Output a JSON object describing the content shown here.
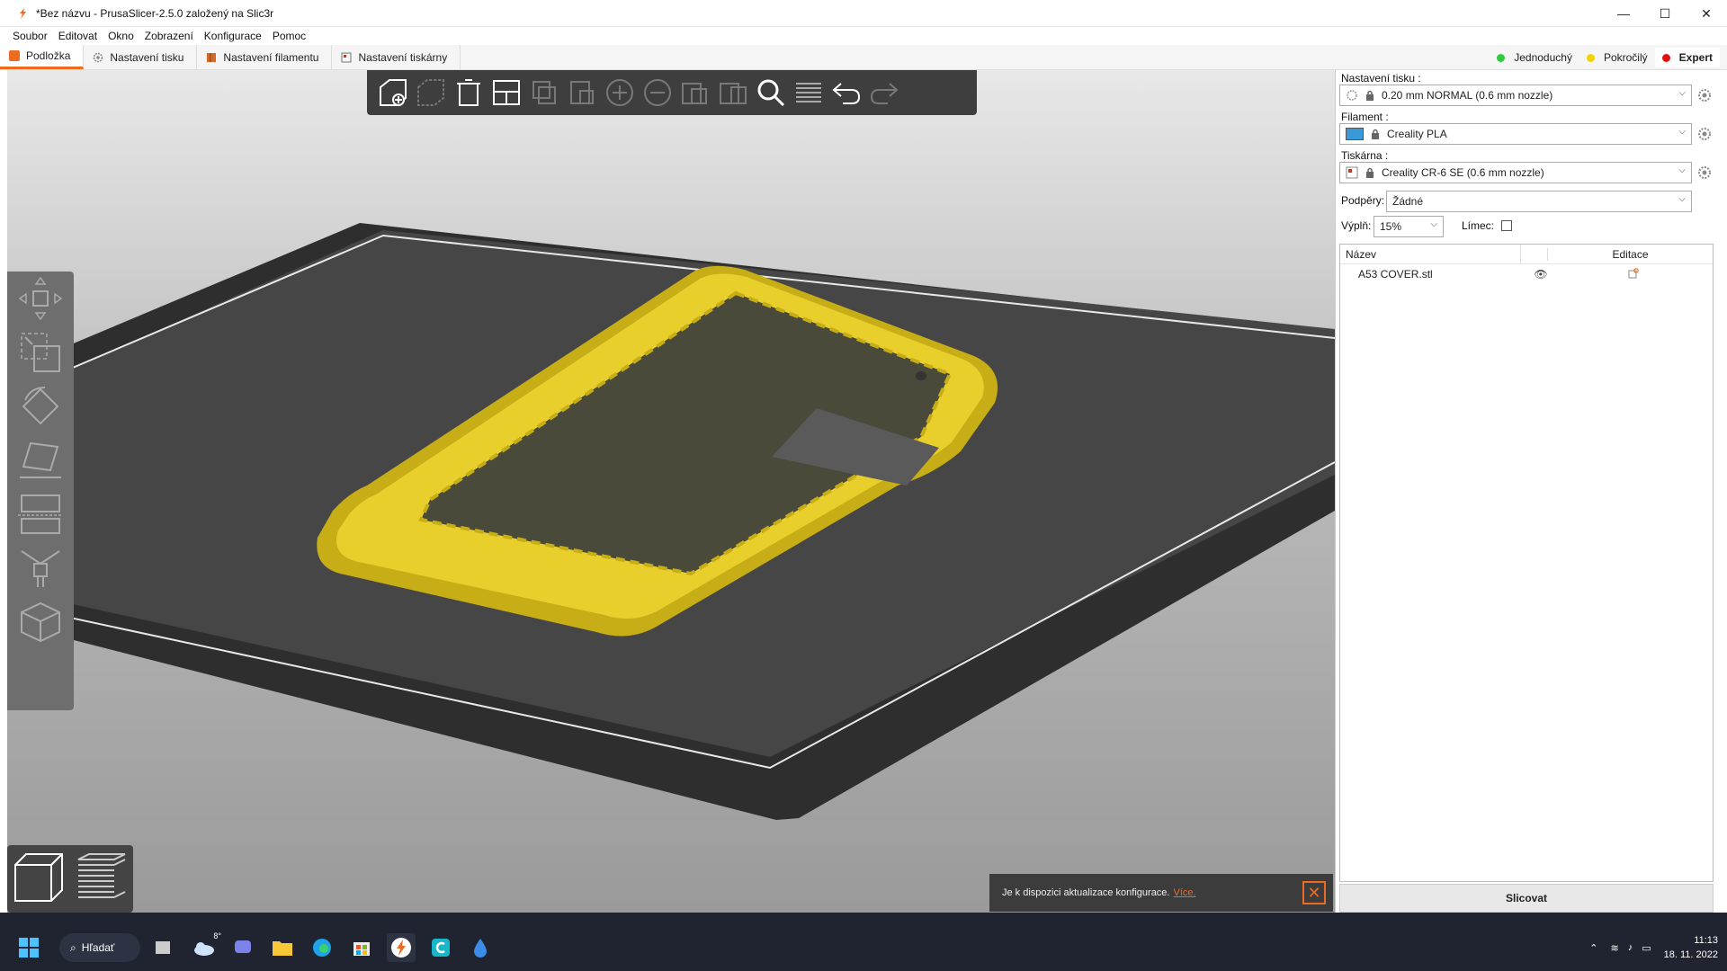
{
  "window": {
    "title": "*Bez názvu - PrusaSlicer-2.5.0 založený na Slic3r",
    "controls": [
      "—",
      "☐",
      "✕"
    ]
  },
  "menu": [
    "Soubor",
    "Editovat",
    "Okno",
    "Zobrazení",
    "Konfigurace",
    "Pomoc"
  ],
  "tabs": [
    {
      "label": "Podložka",
      "color": "#ed6b21"
    },
    {
      "label": "Nastavení tisku",
      "color": "#9a9a9a"
    },
    {
      "label": "Nastavení filamentu",
      "color": "#d36b2e"
    },
    {
      "label": "Nastavení tiskárny",
      "color": "#c0392b"
    }
  ],
  "modes": [
    {
      "label": "Jednoduchý",
      "color": "#2ecc40"
    },
    {
      "label": "Pokročilý",
      "color": "#f2d300"
    },
    {
      "label": "Expert",
      "color": "#e01010"
    }
  ],
  "sidebar": {
    "print_settings_label": "Nastavení tisku :",
    "print_settings_value": "0.20 mm NORMAL (0.6 mm nozzle)",
    "filament_label": "Filament :",
    "filament_value": "Creality PLA",
    "filament_color": "#3a9ad9",
    "printer_label": "Tiskárna :",
    "printer_value": "Creality CR-6 SE (0.6 mm nozzle)",
    "supports_label": "Podpěry:",
    "supports_value": "Žádné",
    "infill_label": "Výplň:",
    "infill_value": "15%",
    "brim_label": "Límec:",
    "col_name": "Název",
    "col_edit": "Editace",
    "objects": [
      {
        "name": "A53 COVER.stl"
      }
    ],
    "slice_button": "Slicovat"
  },
  "notification": {
    "text": "Je k dispozici aktualizace konfigurace.",
    "link": "Více."
  },
  "taskbar": {
    "search": "Hľadať",
    "weather_temp": "8°",
    "time": "11:13",
    "date": "18. 11. 2022"
  },
  "colors": {
    "accent": "#ed6b21",
    "model": "#e8cf2c",
    "bed": "#3a3a3a"
  }
}
